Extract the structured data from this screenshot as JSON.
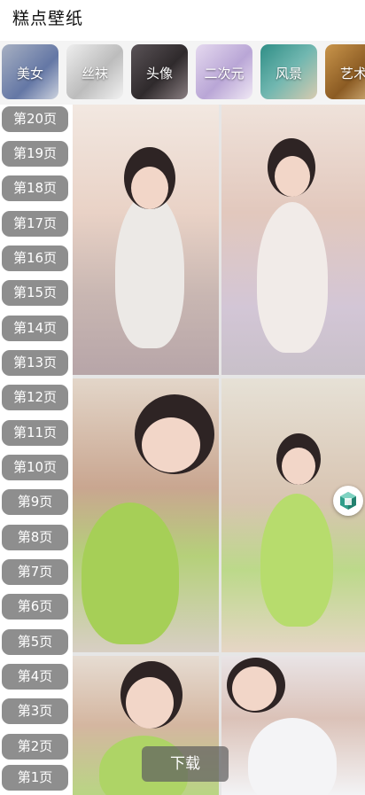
{
  "app": {
    "title": "糕点壁纸"
  },
  "categories": [
    {
      "label": "美女"
    },
    {
      "label": "丝袜"
    },
    {
      "label": "头像"
    },
    {
      "label": "二次元"
    },
    {
      "label": "风景"
    },
    {
      "label": "艺术"
    }
  ],
  "pages": [
    "第20页",
    "第19页",
    "第18页",
    "第17页",
    "第16页",
    "第15页",
    "第14页",
    "第13页",
    "第12页",
    "第11页",
    "第10页",
    "第9页",
    "第8页",
    "第7页",
    "第6页",
    "第5页",
    "第4页",
    "第3页",
    "第2页",
    "第1页"
  ],
  "grid": {
    "photos": [
      {
        "name": "photo-1"
      },
      {
        "name": "photo-2"
      },
      {
        "name": "photo-3"
      },
      {
        "name": "photo-4"
      },
      {
        "name": "photo-5"
      },
      {
        "name": "photo-6"
      }
    ]
  },
  "actions": {
    "download_label": "下载",
    "floating_icon": "cube-icon"
  },
  "colors": {
    "page_button": "#8e8e8e",
    "accent_green": "#2f9e8a"
  }
}
